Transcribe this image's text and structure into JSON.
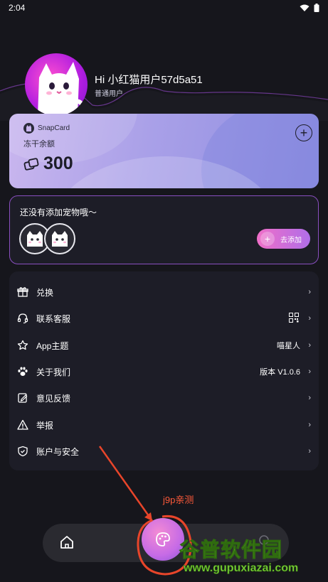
{
  "status_bar": {
    "time": "2:04"
  },
  "profile": {
    "greeting": "Hi 小红猫用户57d5a51",
    "user_type": "普通用户"
  },
  "snapcard": {
    "brand": "SnapCard",
    "label": "冻干余额",
    "amount": "300",
    "add_symbol": "+"
  },
  "pets": {
    "title": "还没有添加宠物哦～",
    "add_button_label": "去添加",
    "add_button_symbol": "+"
  },
  "menu": {
    "items": [
      {
        "label": "兑换",
        "value": "",
        "icon": "gift-icon"
      },
      {
        "label": "联系客服",
        "value": "",
        "icon": "headset-icon"
      },
      {
        "label": "App主题",
        "value": "喵星人",
        "icon": "theme-icon"
      },
      {
        "label": "关于我们",
        "value": "版本 V1.0.6",
        "icon": "paw-icon"
      },
      {
        "label": "意见反馈",
        "value": "",
        "icon": "feedback-icon"
      },
      {
        "label": "举报",
        "value": "",
        "icon": "warning-icon"
      },
      {
        "label": "账户与安全",
        "value": "",
        "icon": "shield-icon"
      }
    ],
    "chevron": "›"
  },
  "annotation": {
    "text": "j9p亲测"
  },
  "watermark": {
    "text": "谷普软件园",
    "url": "www.gupuxiazai.com"
  },
  "colors": {
    "background": "#16161c",
    "card": "#1d1d27",
    "accent_pink": "#f06fc8",
    "accent_purple": "#b06ee8",
    "annotation_red": "#ff5a3a",
    "watermark_green": "#7ed23a"
  }
}
